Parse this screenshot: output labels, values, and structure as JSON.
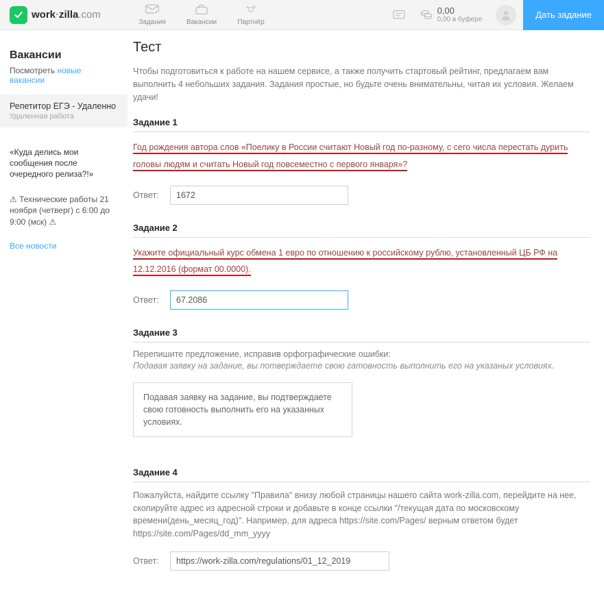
{
  "header": {
    "logo": {
      "brand_a": "work",
      "dot": "·",
      "brand_b": "zilla",
      "suffix": ".com"
    },
    "nav": [
      {
        "label": "Задания"
      },
      {
        "label": "Вакансии"
      },
      {
        "label": "Партнёр"
      }
    ],
    "balance": {
      "amount": "0,00",
      "sub": "0,00 в буфере"
    },
    "post_button": "Дать задание"
  },
  "sidebar": {
    "dim_top": "",
    "heading": "Вакансии",
    "look_prefix": "Посмотреть ",
    "look_link": "новые вакансии",
    "block": {
      "title": "Репетитор ЕГЭ - Удаленно",
      "sub": "Удаленная работа"
    },
    "quote": "«Куда делись мои сообщения после очередного релиза?!»",
    "warn": "⚠ Технические работы 21 ноября (четверг) с 6:00 до 9:00 (мск) ⚠",
    "all_news": "Все новости"
  },
  "main": {
    "title": "Тест",
    "intro": "Чтобы подготовиться к работе на нашем сервисе, а также получить стартовый рейтинг, предлагаем вам выполнить 4 небольших задания. Задания простые, но будьте очень внимательны, читая их условия. Желаем удачи!",
    "answer_label": "Ответ:",
    "t1": {
      "h": "Задание 1",
      "q": "Год рождения автора слов «Поелику в России считают Новый год по-разному, с сего числа перестать дурить головы людям и считать Новый год повсеместно с первого января»?",
      "value": "1672"
    },
    "t2": {
      "h": "Задание 2",
      "q": "Укажите официальный курс обмена 1 евро по отношению к российскому рублю, установленный ЦБ РФ на 12.12.2016 (формат 00.0000).",
      "value": "67.2086"
    },
    "t3": {
      "h": "Задание 3",
      "sub": "Перепишите предложение, исправив орфографические ошибки:",
      "ital": "Подавая заявку на задание, вы потверждаете свою гатовность выполнить его на указаных условиях.",
      "box": "Подавая заявку на задание, вы подтверждаете свою готовность выполнить его на указанных условиях."
    },
    "t4": {
      "h": "Задание 4",
      "q": "Пожалуйста, найдите ссылку \"Правила\" внизу любой страницы нашего сайта work-zilla.com, перейдите на нее, скопируйте адрес из адресной строки и добавьте в конце ссылки \"/текущая дата по московскому времени(день_месяц_год)\". Например, для адреса https://site.com/Pages/ верным ответом будет https://site.com/Pages/dd_mm_yyyy",
      "value": "https://work-zilla.com/regulations/01_12_2019"
    }
  }
}
